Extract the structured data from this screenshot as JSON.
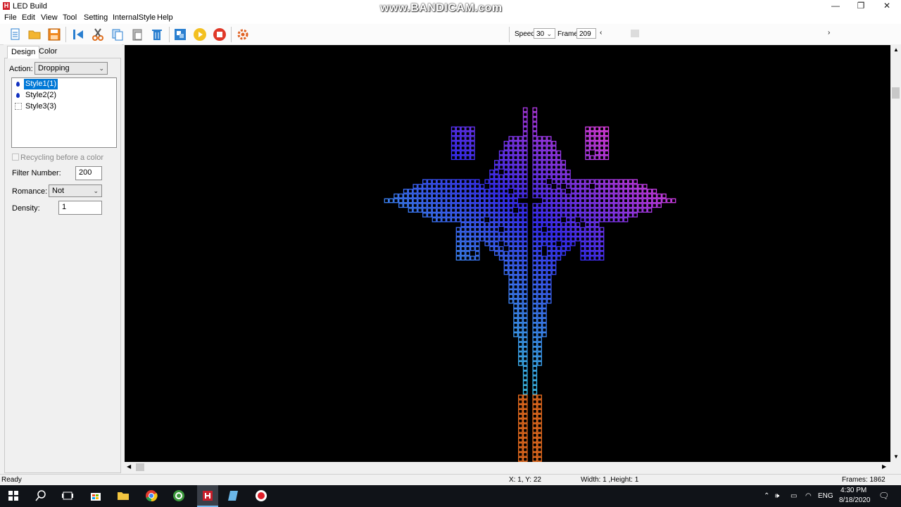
{
  "window": {
    "title": "LED Build",
    "watermark": "www.BANDICAM.com",
    "minimize": "—",
    "restore": "❐",
    "close": "✕"
  },
  "menu": [
    "File",
    "Edit",
    "View",
    "Tool",
    "Setting",
    "InternalStyle",
    "Help"
  ],
  "toolbar": {
    "icons": [
      "new-file-icon",
      "open-folder-icon",
      "save-icon",
      "import-icon",
      "cut-icon",
      "copy-icon",
      "paste-icon",
      "delete-icon",
      "transform-icon",
      "play-icon",
      "stop-icon",
      "settings-gear-icon"
    ],
    "speed_label": "Speed:",
    "speed_value": "30",
    "frame_label": "Frame:",
    "frame_value": "209"
  },
  "tabs": [
    "Design",
    "Color"
  ],
  "panel": {
    "action_label": "Action:",
    "action_value": "Dropping",
    "styles": [
      {
        "label": "Style1(1)",
        "selected": true,
        "icon": "drop-icon"
      },
      {
        "label": "Style2(2)",
        "selected": false,
        "icon": "drop-icon"
      },
      {
        "label": "Style3(3)",
        "selected": false,
        "icon": "star-icon"
      }
    ],
    "recycling_label": "Recycling before a color",
    "filter_label": "Filter Number:",
    "filter_value": "200",
    "romance_label": "Romance:",
    "romance_value": "Not",
    "density_label": "Density:",
    "density_value": "1"
  },
  "status": {
    "ready": "Ready",
    "coords": "X: 1, Y: 22",
    "size": "Width: 1 ,Height: 1",
    "frames": "Frames: 1862"
  },
  "taskbar": {
    "lang": "ENG",
    "time": "4:30 PM",
    "date": "8/18/2020"
  },
  "colors": {
    "gradient_top": "#e640e6",
    "gradient_mid": "#3a30ff",
    "gradient_bottom": "#40e8f0",
    "tail": "#f07020"
  }
}
